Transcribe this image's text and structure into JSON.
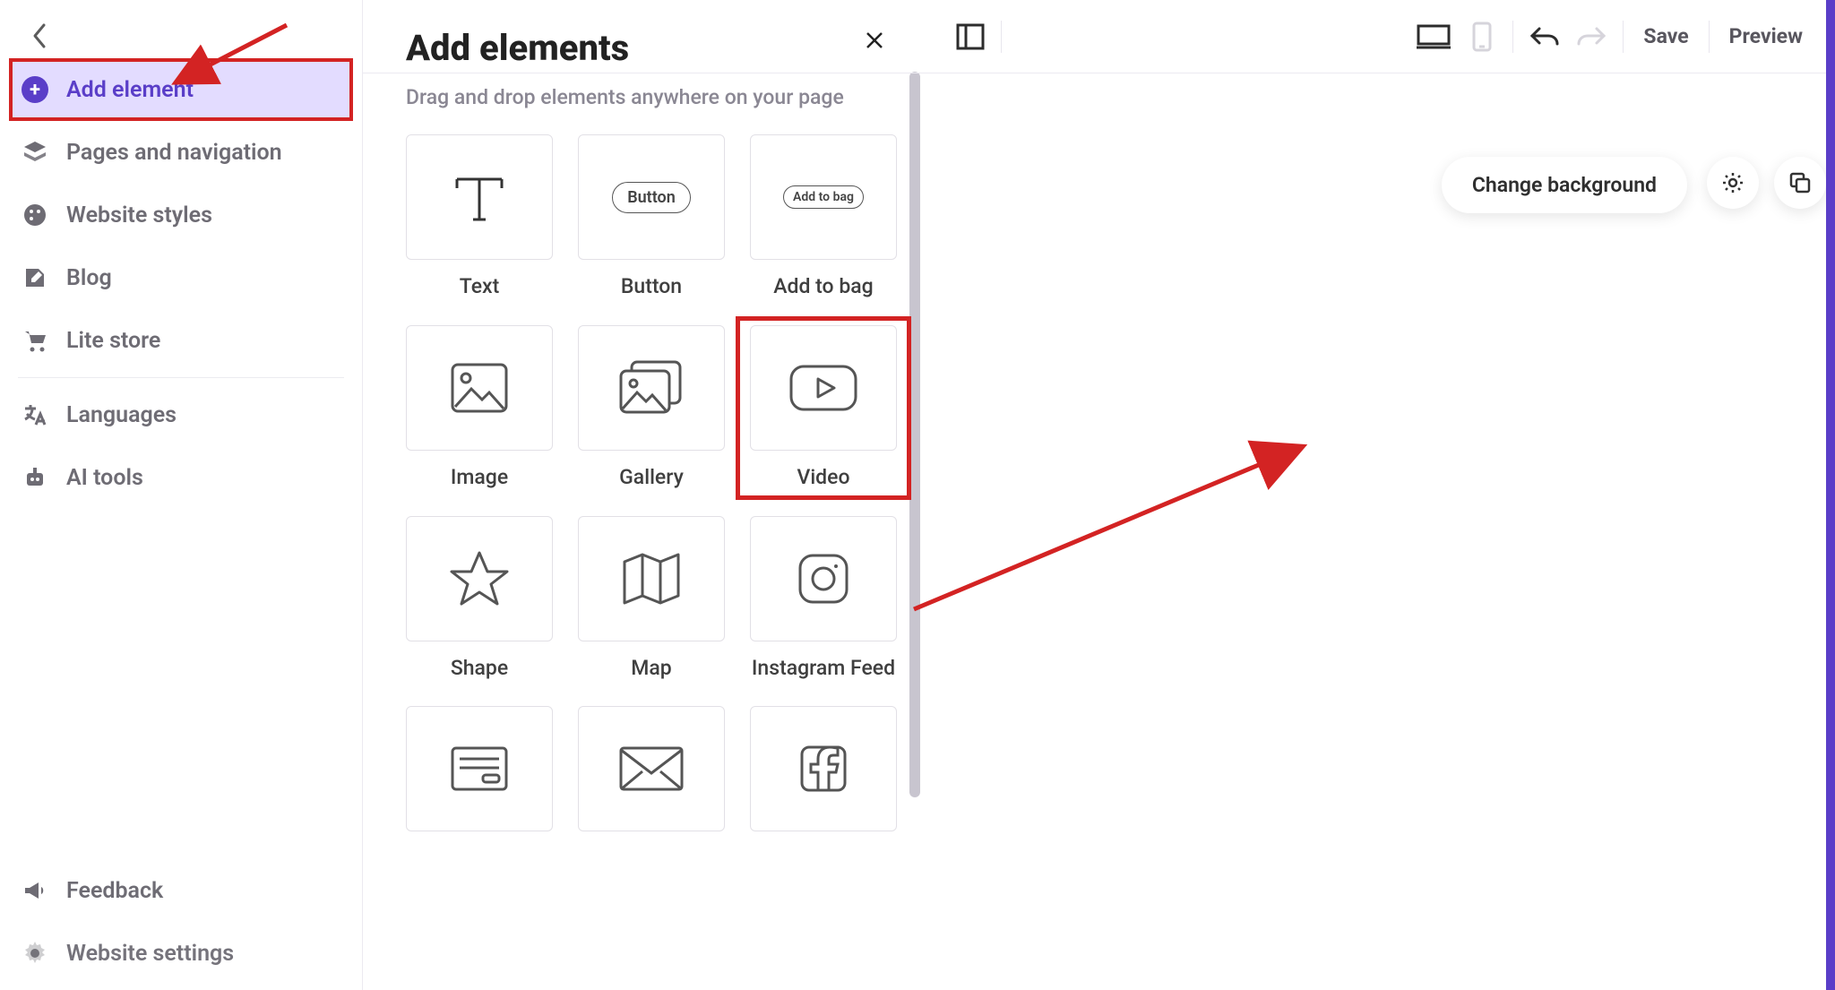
{
  "sidebar": {
    "items": [
      {
        "label": "Add element"
      },
      {
        "label": "Pages and navigation"
      },
      {
        "label": "Website styles"
      },
      {
        "label": "Blog"
      },
      {
        "label": "Lite store"
      },
      {
        "label": "Languages"
      },
      {
        "label": "AI tools"
      }
    ],
    "footer": [
      {
        "label": "Feedback"
      },
      {
        "label": "Website settings"
      }
    ]
  },
  "panel": {
    "title": "Add elements",
    "subtitle": "Drag and drop elements anywhere on your page",
    "button_chip": "Button",
    "addtobag_chip": "Add to bag",
    "tiles": [
      {
        "label": "Text"
      },
      {
        "label": "Button"
      },
      {
        "label": "Add to bag"
      },
      {
        "label": "Image"
      },
      {
        "label": "Gallery"
      },
      {
        "label": "Video"
      },
      {
        "label": "Shape"
      },
      {
        "label": "Map"
      },
      {
        "label": "Instagram Feed"
      },
      {
        "label": ""
      },
      {
        "label": ""
      },
      {
        "label": ""
      }
    ]
  },
  "topbar": {
    "save": "Save",
    "preview": "Preview"
  },
  "canvas": {
    "change_bg": "Change background"
  }
}
